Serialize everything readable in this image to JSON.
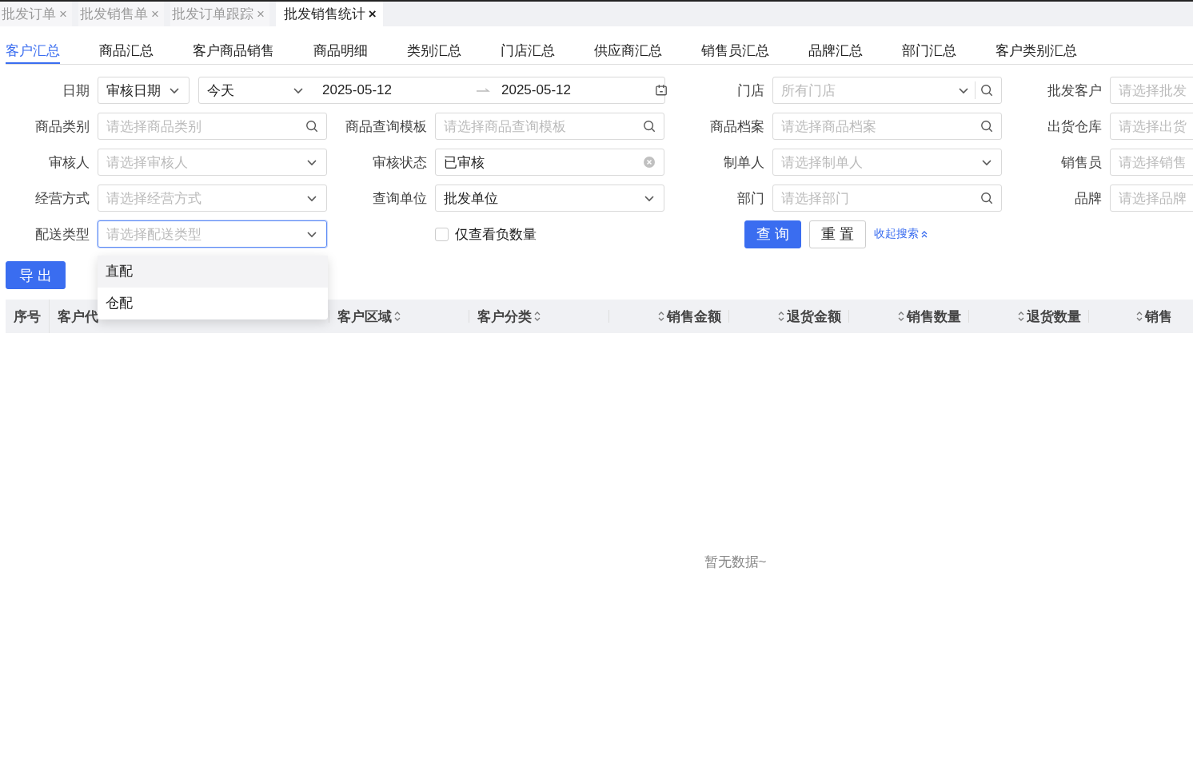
{
  "page_tabs": [
    {
      "label": "批发订单",
      "selected": false,
      "close": "×"
    },
    {
      "label": "批发销售单",
      "selected": false,
      "close": "×"
    },
    {
      "label": "批发订单跟踪",
      "selected": false,
      "close": "×"
    },
    {
      "label": "批发销售统计",
      "selected": true,
      "close": "×"
    }
  ],
  "report_tabs": [
    {
      "label": "客户汇总",
      "selected": true
    },
    {
      "label": "商品汇总",
      "selected": false
    },
    {
      "label": "客户商品销售",
      "selected": false
    },
    {
      "label": "商品明细",
      "selected": false
    },
    {
      "label": "类别汇总",
      "selected": false
    },
    {
      "label": "门店汇总",
      "selected": false
    },
    {
      "label": "供应商汇总",
      "selected": false
    },
    {
      "label": "销售员汇总",
      "selected": false
    },
    {
      "label": "品牌汇总",
      "selected": false
    },
    {
      "label": "部门汇总",
      "selected": false
    },
    {
      "label": "客户类别汇总",
      "selected": false
    }
  ],
  "filters": [
    {
      "kind": "date_range",
      "label": "日期",
      "date_type": "审核日期",
      "preset": "今天",
      "start": "2025-05-12",
      "end": "2025-05-12"
    },
    {
      "kind": "store",
      "label": "门店",
      "placeholder": "所有门店"
    },
    {
      "kind": "field",
      "label": "批发客户",
      "placeholder": "请选择批发"
    },
    {
      "kind": "search",
      "label": "商品类别",
      "placeholder": "请选择商品类别"
    },
    {
      "kind": "search",
      "label": "商品查询模板",
      "placeholder": "请选择商品查询模板"
    },
    {
      "kind": "search",
      "label": "商品档案",
      "placeholder": "请选择商品档案"
    },
    {
      "kind": "field",
      "label": "出货仓库",
      "placeholder": "请选择出货"
    },
    {
      "kind": "select",
      "label": "审核人",
      "placeholder": "请选择审核人"
    },
    {
      "kind": "clearable",
      "label": "审核状态",
      "value": "已审核"
    },
    {
      "kind": "select",
      "label": "制单人",
      "placeholder": "请选择制单人"
    },
    {
      "kind": "field",
      "label": "销售员",
      "placeholder": "请选择销售"
    },
    {
      "kind": "select",
      "label": "经营方式",
      "placeholder": "请选择经营方式"
    },
    {
      "kind": "select",
      "label": "查询单位",
      "value": "批发单位"
    },
    {
      "kind": "search",
      "label": "部门",
      "placeholder": "请选择部门"
    },
    {
      "kind": "field",
      "label": "品牌",
      "placeholder": "请选择品牌"
    },
    {
      "kind": "select",
      "label": "配送类型",
      "placeholder": "请选择配送类型",
      "focused": true,
      "options": [
        {
          "label": "直配",
          "highlighted": true
        },
        {
          "label": "仓配",
          "highlighted": false
        }
      ]
    },
    {
      "kind": "checkbox",
      "label": "仅查看负数量",
      "checked": false
    },
    {
      "kind": "actions",
      "query": "查 询",
      "reset": "重 置",
      "collapse": "收起搜索"
    }
  ],
  "export_button": "导 出",
  "table": {
    "columns": [
      {
        "label": "序号",
        "kind": "index",
        "sortable": false
      },
      {
        "label": "客户代",
        "kind": "code",
        "sortable": false
      },
      {
        "label": "客户区域",
        "kind": "text",
        "sortable": true
      },
      {
        "label": "客户分类",
        "kind": "text",
        "sortable": true
      },
      {
        "label": "销售金额",
        "kind": "number",
        "sortable": true
      },
      {
        "label": "退货金额",
        "kind": "number",
        "sortable": true
      },
      {
        "label": "销售数量",
        "kind": "number",
        "sortable": true
      },
      {
        "label": "退货数量",
        "kind": "number",
        "sortable": true
      },
      {
        "label": "销售",
        "kind": "number",
        "sortable": true
      }
    ],
    "empty_text": "暂无数据~"
  }
}
